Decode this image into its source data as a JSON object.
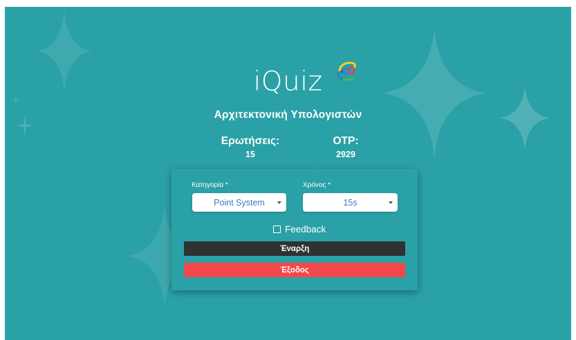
{
  "app": {
    "brand": "iQuiz"
  },
  "quiz": {
    "subject": "Αρχιτεκτονική Υπολογιστών",
    "questions_label": "Ερωτήσεις:",
    "questions_value": "15",
    "otp_label": "OTP:",
    "otp_value": "2929"
  },
  "form": {
    "category_label": "Κατηγορία *",
    "category_value": "Point System",
    "time_label": "Χρόνος *",
    "time_value": "15s",
    "feedback_label": "Feedback",
    "feedback_checked": false,
    "start_label": "Έναρξη",
    "exit_label": "Έξοδος"
  },
  "colors": {
    "background": "#2aa0a7",
    "start_button": "#2f3133",
    "exit_button": "#f2474b",
    "select_text": "#3a79c3"
  }
}
